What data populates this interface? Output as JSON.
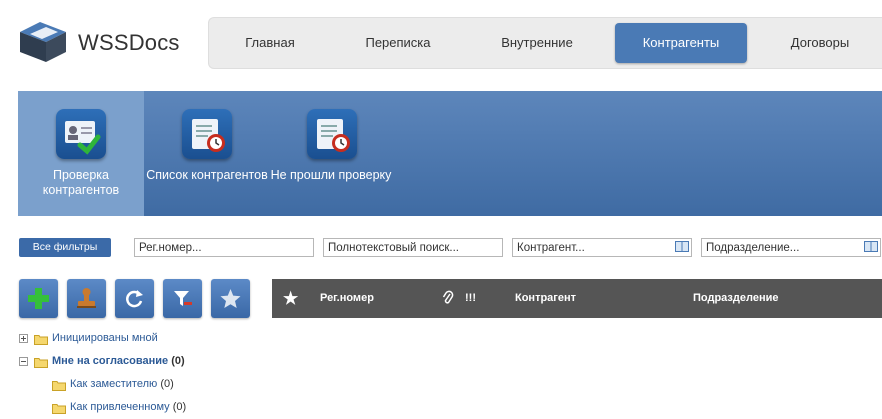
{
  "app": {
    "logo_text": "WSSDocs"
  },
  "topnav": {
    "items": [
      {
        "label": "Главная"
      },
      {
        "label": "Переписка"
      },
      {
        "label": "Внутренние"
      },
      {
        "label": "Контрагенты"
      },
      {
        "label": "Договоры"
      }
    ],
    "active_index": 3
  },
  "ribbon": {
    "items": [
      {
        "label_line1": "Проверка",
        "label_line2": "контрагентов",
        "icon": "id-card-check-icon",
        "selected": true
      },
      {
        "label": "Список контрагентов",
        "icon": "list-clock-icon"
      },
      {
        "label": "Не прошли проверку",
        "icon": "list-clock-icon"
      }
    ]
  },
  "filters": {
    "all_filters_label": "Все фильтры",
    "reg_number_placeholder": "Рег.номер...",
    "fulltext_placeholder": "Полнотекстовый поиск...",
    "counterparty_placeholder": "Контрагент...",
    "department_placeholder": "Подразделение..."
  },
  "toolbar": {
    "buttons": [
      "add-icon",
      "stamp-icon",
      "refresh-icon",
      "filter-clear-icon",
      "star-icon"
    ]
  },
  "grid": {
    "columns": {
      "favorite": "★",
      "reg_number": "Рег.номер",
      "attachment": "attachment-icon",
      "importance": "!!!",
      "counterparty": "Контрагент",
      "department": "Подразделение"
    }
  },
  "tree": {
    "items": [
      {
        "label": "Инициированы мной",
        "expanded": false
      },
      {
        "label": "Мне на согласование",
        "count": "(0)",
        "expanded": true,
        "bold": true
      },
      {
        "label": "Как заместителю",
        "count": "(0)"
      },
      {
        "label": "Как привлеченному",
        "count": "(0)"
      }
    ]
  },
  "colors": {
    "brand_blue": "#3b6aa8",
    "ribbon_top": "#5d86bb",
    "ribbon_selected": "#7ba0cc",
    "grid_header": "#555555",
    "link": "#2c5a96"
  }
}
